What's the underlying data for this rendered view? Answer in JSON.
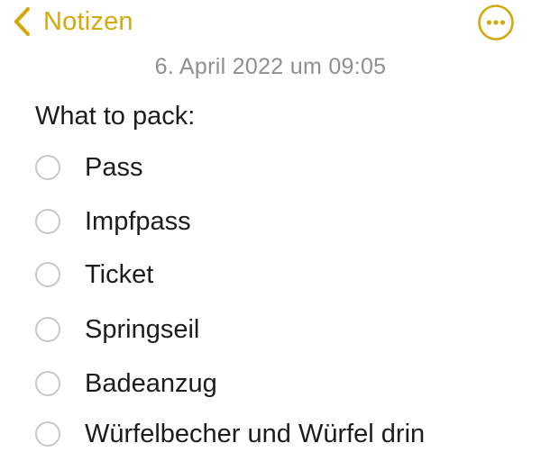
{
  "colors": {
    "accent": "#d4a90c",
    "secondary_text": "#8e8e93",
    "primary_text": "#1c1c1e",
    "checkbox_border": "#c7c7cc"
  },
  "nav": {
    "back_label": "Notizen",
    "back_icon": "chevron-left-icon",
    "more_icon": "ellipsis-circle-icon"
  },
  "note": {
    "date": "6. April 2022 um 09:05",
    "heading": "What to pack:",
    "items": [
      {
        "label": "Pass",
        "checked": false
      },
      {
        "label": "Impfpass",
        "checked": false
      },
      {
        "label": "Ticket",
        "checked": false
      },
      {
        "label": "Springseil",
        "checked": false
      },
      {
        "label": "Badeanzug",
        "checked": false
      },
      {
        "label": "Würfelbecher und Würfel drin",
        "checked": false
      }
    ]
  }
}
